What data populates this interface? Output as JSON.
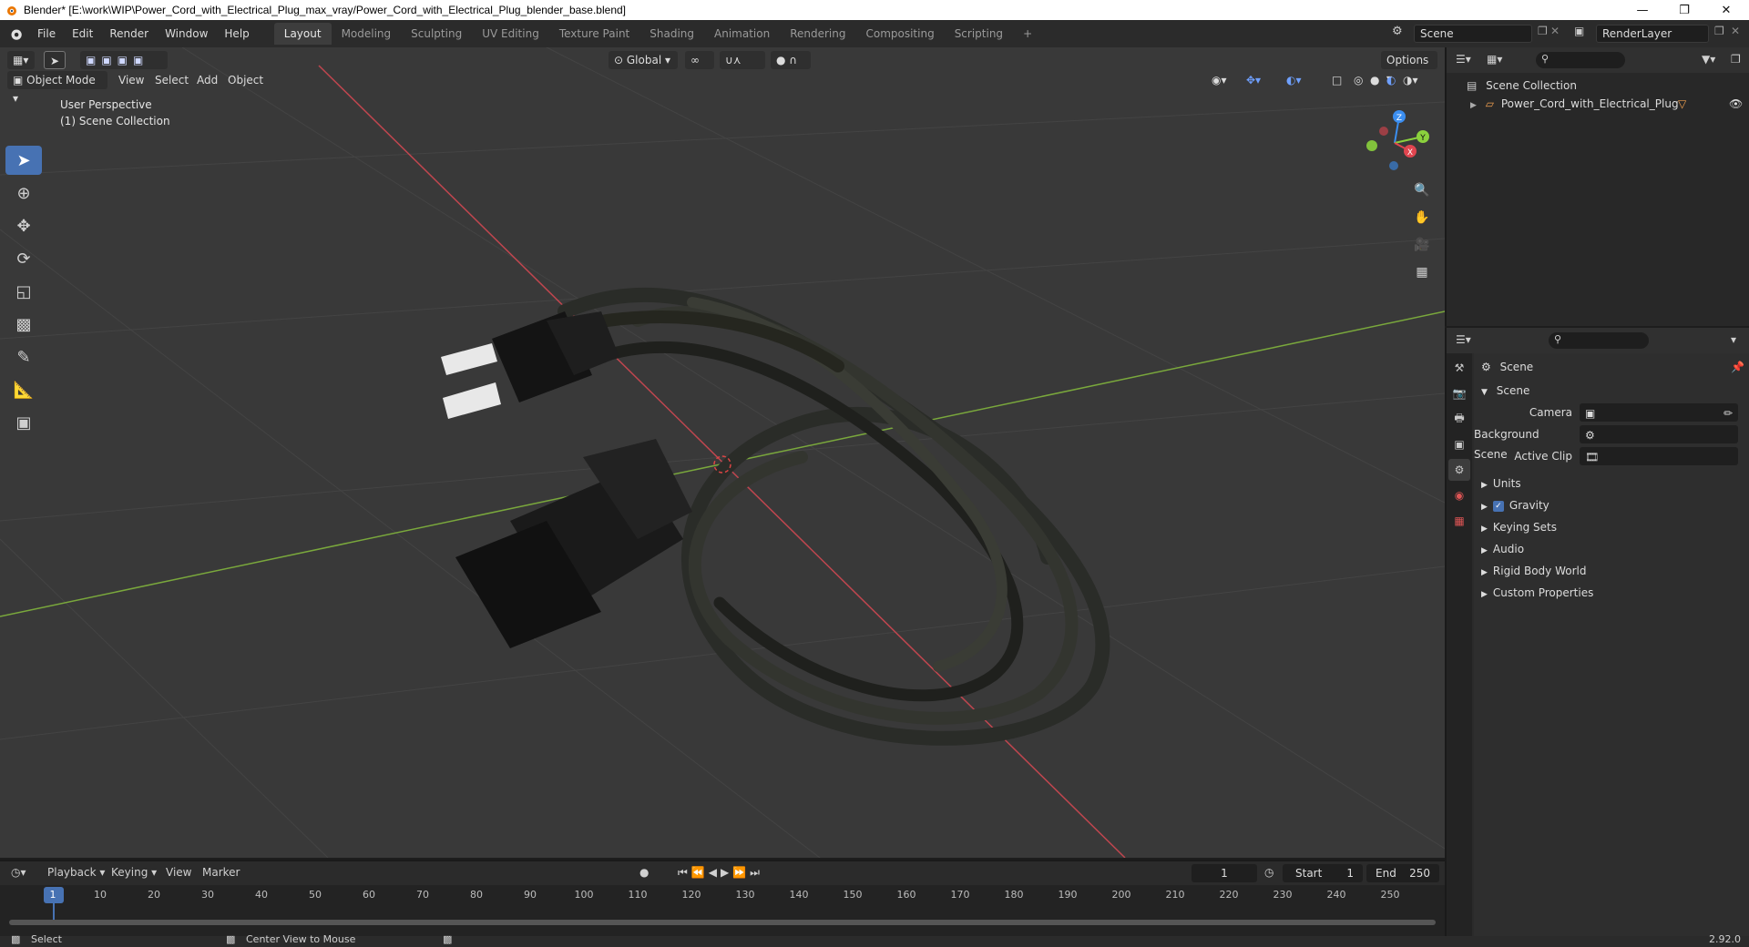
{
  "window": {
    "title": "Blender* [E:\\work\\WIP\\Power_Cord_with_Electrical_Plug_max_vray/Power_Cord_with_Electrical_Plug_blender_base.blend]"
  },
  "menu": [
    "File",
    "Edit",
    "Render",
    "Window",
    "Help"
  ],
  "workspaces": [
    "Layout",
    "Modeling",
    "Sculpting",
    "UV Editing",
    "Texture Paint",
    "Shading",
    "Animation",
    "Rendering",
    "Compositing",
    "Scripting"
  ],
  "top_right": {
    "scene": "Scene",
    "render_layer": "RenderLayer"
  },
  "viewport": {
    "mode": "Object Mode",
    "menus": [
      "View",
      "Select",
      "Add",
      "Object"
    ],
    "transform_orientation": "Global",
    "options": "Options",
    "perspective": "User Perspective",
    "collection": "(1) Scene Collection",
    "gizmo": {
      "z": "Z",
      "y": "Y",
      "x": "X"
    }
  },
  "outliner": {
    "root": "Scene Collection",
    "items": [
      "Power_Cord_with_Electrical_Plug"
    ]
  },
  "properties": {
    "context": "Scene",
    "section": "Scene",
    "camera_label": "Camera",
    "background_scene_label": "Background Scene",
    "active_clip_label": "Active Clip",
    "panels": [
      "Units",
      "Gravity",
      "Keying Sets",
      "Audio",
      "Rigid Body World",
      "Custom Properties"
    ],
    "gravity_checked": true
  },
  "timeline": {
    "menus": [
      "Playback",
      "Keying",
      "View",
      "Marker"
    ],
    "current_frame": "1",
    "start_label": "Start",
    "start": "1",
    "end_label": "End",
    "end": "250",
    "ticks": [
      "1",
      "10",
      "20",
      "30",
      "40",
      "50",
      "60",
      "70",
      "80",
      "90",
      "100",
      "110",
      "120",
      "130",
      "140",
      "150",
      "160",
      "170",
      "180",
      "190",
      "200",
      "210",
      "220",
      "230",
      "240",
      "250"
    ]
  },
  "status": {
    "select": "Select",
    "center_view": "Center View to Mouse",
    "version": "2.92.0"
  },
  "colors": {
    "accent": "#4772b3",
    "x_axis": "#e0454f",
    "y_axis": "#8bd13d",
    "z_axis": "#3b8ef0"
  }
}
